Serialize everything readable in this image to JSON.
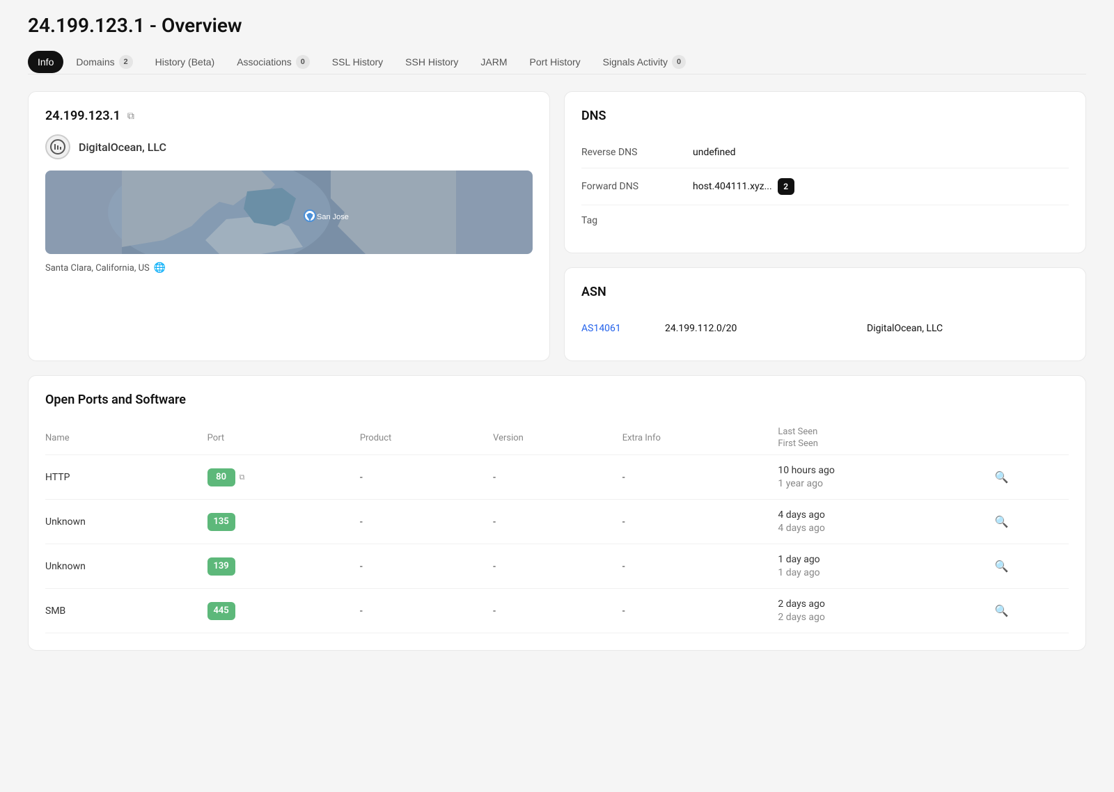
{
  "page": {
    "title": "24.199.123.1 - Overview"
  },
  "tabs": [
    {
      "id": "info",
      "label": "Info",
      "active": true,
      "badge": null
    },
    {
      "id": "domains",
      "label": "Domains",
      "active": false,
      "badge": "2"
    },
    {
      "id": "history",
      "label": "History (Beta)",
      "active": false,
      "badge": null
    },
    {
      "id": "associations",
      "label": "Associations",
      "active": false,
      "badge": "0"
    },
    {
      "id": "ssl-history",
      "label": "SSL History",
      "active": false,
      "badge": null
    },
    {
      "id": "ssh-history",
      "label": "SSH History",
      "active": false,
      "badge": null
    },
    {
      "id": "jarm",
      "label": "JARM",
      "active": false,
      "badge": null
    },
    {
      "id": "port-history",
      "label": "Port History",
      "active": false,
      "badge": null
    },
    {
      "id": "signals-activity",
      "label": "Signals Activity",
      "active": false,
      "badge": "0"
    }
  ],
  "info_card": {
    "ip": "24.199.123.1",
    "org_name": "DigitalOcean, LLC",
    "org_icon": "⊙",
    "location": "Santa Clara, California, US",
    "map_city": "San Jose"
  },
  "dns": {
    "title": "DNS",
    "reverse_dns_label": "Reverse DNS",
    "reverse_dns_value": "undefined",
    "forward_dns_label": "Forward DNS",
    "forward_dns_value": "host.404111.xyz...",
    "forward_dns_count": "2",
    "tag_label": "Tag",
    "tag_value": ""
  },
  "asn": {
    "title": "ASN",
    "asn_id": "AS14061",
    "asn_range": "24.199.112.0/20",
    "asn_org": "DigitalOcean, LLC"
  },
  "ports": {
    "title": "Open Ports and Software",
    "columns": {
      "name": "Name",
      "port": "Port",
      "product": "Product",
      "version": "Version",
      "extra_info": "Extra Info",
      "last_seen": "Last Seen",
      "first_seen": "First Seen"
    },
    "rows": [
      {
        "name": "HTTP",
        "port": "80",
        "product": "-",
        "version": "-",
        "extra_info": "-",
        "last_seen": "10 hours ago",
        "first_seen": "1 year ago",
        "has_external_link": true
      },
      {
        "name": "Unknown",
        "port": "135",
        "product": "-",
        "version": "-",
        "extra_info": "-",
        "last_seen": "4 days ago",
        "first_seen": "4 days ago",
        "has_external_link": false
      },
      {
        "name": "Unknown",
        "port": "139",
        "product": "-",
        "version": "-",
        "extra_info": "-",
        "last_seen": "1 day ago",
        "first_seen": "1 day ago",
        "has_external_link": false
      },
      {
        "name": "SMB",
        "port": "445",
        "product": "-",
        "version": "-",
        "extra_info": "-",
        "last_seen": "2 days ago",
        "first_seen": "2 days ago",
        "has_external_link": false
      }
    ]
  }
}
